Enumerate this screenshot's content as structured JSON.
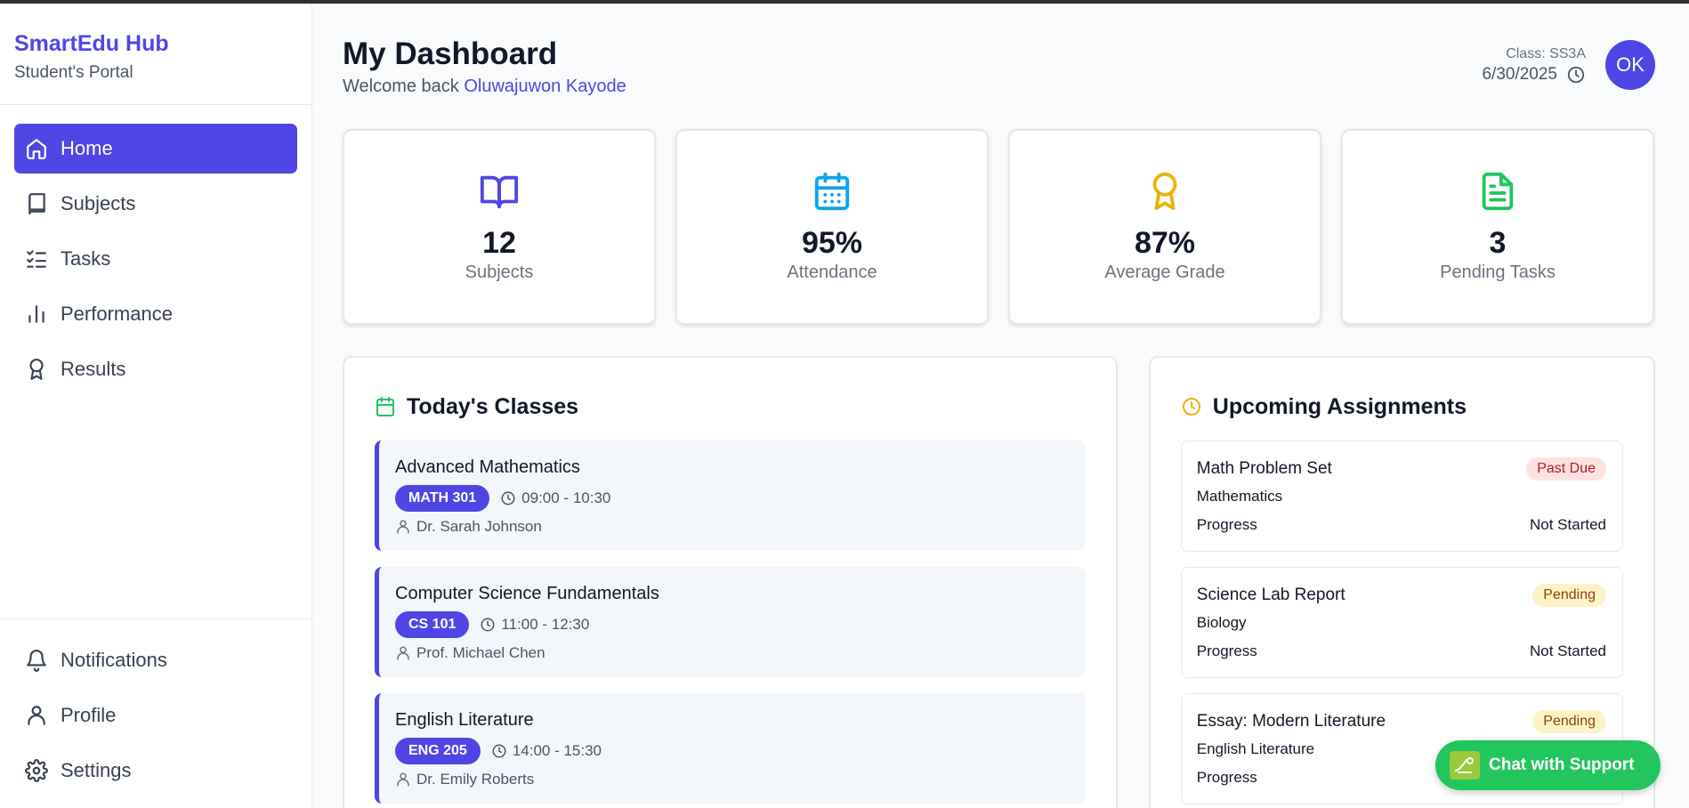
{
  "brand": {
    "title": "SmartEdu Hub",
    "subtitle": "Student's Portal"
  },
  "sidebar": {
    "items": [
      {
        "label": "Home",
        "icon": "home-icon",
        "active": true
      },
      {
        "label": "Subjects",
        "icon": "book-icon",
        "active": false
      },
      {
        "label": "Tasks",
        "icon": "list-checks-icon",
        "active": false
      },
      {
        "label": "Performance",
        "icon": "bar-chart-icon",
        "active": false
      },
      {
        "label": "Results",
        "icon": "award-icon",
        "active": false
      }
    ],
    "bottom_items": [
      {
        "label": "Notifications",
        "icon": "bell-icon"
      },
      {
        "label": "Profile",
        "icon": "user-icon"
      },
      {
        "label": "Settings",
        "icon": "gear-icon"
      }
    ]
  },
  "header": {
    "title": "My Dashboard",
    "welcome_prefix": "Welcome back",
    "user_name": "Oluwajuwon Kayode",
    "class_label": "Class: SS3A",
    "date": "6/30/2025",
    "avatar_initials": "OK"
  },
  "stats": [
    {
      "value": "12",
      "label": "Subjects",
      "icon": "book-open-icon",
      "color": "#4f46e5"
    },
    {
      "value": "95%",
      "label": "Attendance",
      "icon": "calendar-icon",
      "color": "#0ea5e9"
    },
    {
      "value": "87%",
      "label": "Average Grade",
      "icon": "award-icon",
      "color": "#eab308"
    },
    {
      "value": "3",
      "label": "Pending Tasks",
      "icon": "file-text-icon",
      "color": "#22c55e"
    }
  ],
  "classes": {
    "title": "Today's Classes",
    "items": [
      {
        "name": "Advanced Mathematics",
        "code": "MATH 301",
        "time": "09:00 - 10:30",
        "teacher": "Dr. Sarah Johnson"
      },
      {
        "name": "Computer Science Fundamentals",
        "code": "CS 101",
        "time": "11:00 - 12:30",
        "teacher": "Prof. Michael Chen"
      },
      {
        "name": "English Literature",
        "code": "ENG 205",
        "time": "14:00 - 15:30",
        "teacher": "Dr. Emily Roberts"
      }
    ]
  },
  "assignments": {
    "title": "Upcoming Assignments",
    "items": [
      {
        "title": "Math Problem Set",
        "status": "Past Due",
        "subject": "Mathematics",
        "progress_label": "Progress",
        "progress_value": "Not Started"
      },
      {
        "title": "Science Lab Report",
        "status": "Pending",
        "subject": "Biology",
        "progress_label": "Progress",
        "progress_value": "Not Started"
      },
      {
        "title": "Essay: Modern Literature",
        "status": "Pending",
        "subject": "English Literature",
        "progress_label": "Progress",
        "progress_value": ""
      }
    ]
  },
  "chat": {
    "label": "Chat with Support"
  },
  "colors": {
    "accent": "#4f46e5",
    "chat": "#22c55e"
  }
}
